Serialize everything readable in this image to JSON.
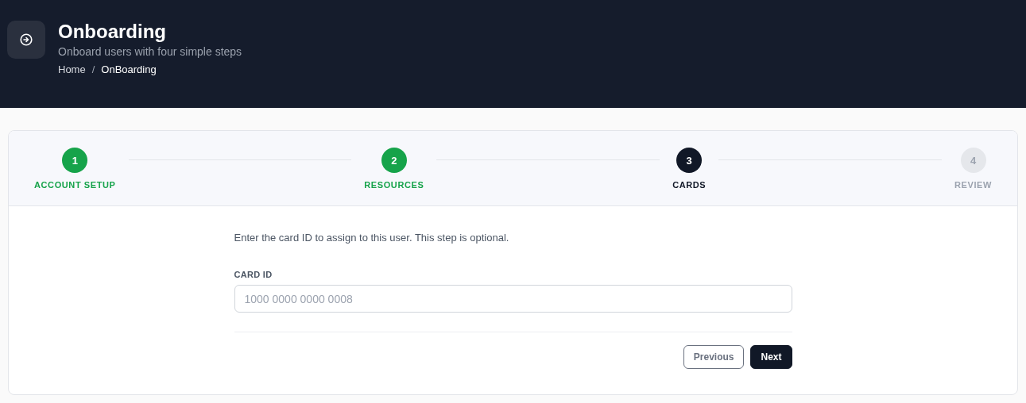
{
  "header": {
    "title": "Onboarding",
    "subtitle": "Onboard users with four simple steps",
    "breadcrumb": [
      "Home",
      "OnBoarding"
    ],
    "separator": "/"
  },
  "steps": [
    {
      "number": "1",
      "label": "ACCOUNT SETUP",
      "completed": true,
      "selected": false
    },
    {
      "number": "2",
      "label": "RESOURCES",
      "completed": true,
      "selected": false
    },
    {
      "number": "3",
      "label": "CARDS",
      "completed": false,
      "selected": true
    },
    {
      "number": "4",
      "label": "REVIEW",
      "completed": false,
      "selected": false
    }
  ],
  "form": {
    "intro": "Enter the card ID to assign to this user. This step is optional.",
    "field_label": "CARD ID",
    "placeholder": "1000 0000 0000 0008"
  },
  "buttons": [
    {
      "label": "Previous",
      "kind": "secondary"
    },
    {
      "label": "Next",
      "kind": "primary"
    }
  ]
}
